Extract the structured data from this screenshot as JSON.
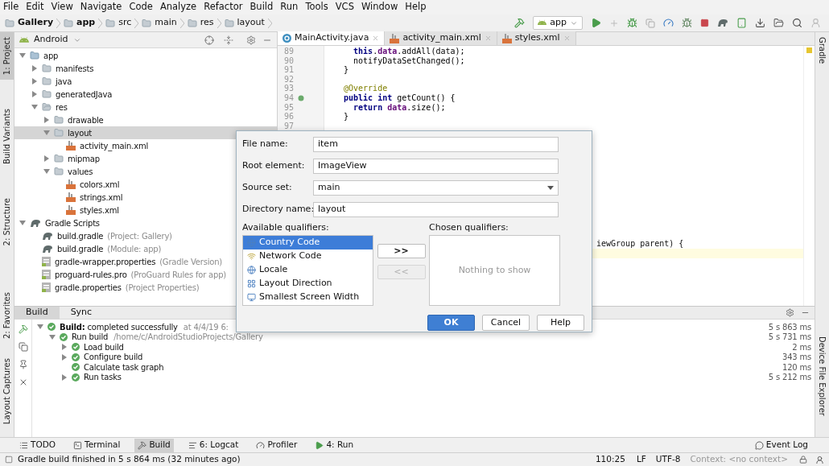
{
  "menu_bar": [
    "File",
    "Edit",
    "View",
    "Navigate",
    "Code",
    "Analyze",
    "Refactor",
    "Build",
    "Run",
    "Tools",
    "VCS",
    "Window",
    "Help"
  ],
  "breadcrumb": [
    "Gallery",
    "app",
    "src",
    "main",
    "res",
    "layout"
  ],
  "run_config": "app",
  "left_stripe_top": [
    {
      "label": "1: Project",
      "selected": true
    },
    {
      "label": "Build Variants",
      "selected": false
    },
    {
      "label": "2: Structure",
      "selected": false
    }
  ],
  "left_stripe_bottom": [
    {
      "label": "2: Favorites",
      "selected": false
    },
    {
      "label": "Layout Captures",
      "selected": false
    }
  ],
  "right_stripe_top": [
    {
      "label": "Gradle"
    }
  ],
  "right_stripe_bottom": [
    {
      "label": "Device File Explorer"
    }
  ],
  "project_panel": {
    "view": "Android",
    "tree": [
      {
        "label": "app",
        "kind": "module",
        "expanded": true,
        "selected": false,
        "children": [
          {
            "label": "manifests",
            "kind": "folder",
            "expanded": false,
            "selected": false
          },
          {
            "label": "java",
            "kind": "folder",
            "expanded": false,
            "selected": false
          },
          {
            "label": "generatedJava",
            "kind": "folder",
            "expanded": false,
            "selected": false
          },
          {
            "label": "res",
            "kind": "resfolder",
            "expanded": true,
            "selected": false,
            "children": [
              {
                "label": "drawable",
                "kind": "folder",
                "expanded": false,
                "selected": false
              },
              {
                "label": "layout",
                "kind": "folder",
                "expanded": true,
                "selected": true,
                "children": [
                  {
                    "label": "activity_main.xml",
                    "kind": "xml",
                    "selected": false
                  }
                ]
              },
              {
                "label": "mipmap",
                "kind": "folder",
                "expanded": false,
                "selected": false
              },
              {
                "label": "values",
                "kind": "folder",
                "expanded": true,
                "selected": false,
                "children": [
                  {
                    "label": "colors.xml",
                    "kind": "xml",
                    "selected": false
                  },
                  {
                    "label": "strings.xml",
                    "kind": "xml",
                    "selected": false
                  },
                  {
                    "label": "styles.xml",
                    "kind": "xml",
                    "selected": false
                  }
                ]
              }
            ]
          }
        ]
      },
      {
        "label": "Gradle Scripts",
        "kind": "gradle",
        "expanded": true,
        "selected": false,
        "children": [
          {
            "label": "build.gradle",
            "secondary": "(Project: Gallery)",
            "kind": "gradle",
            "selected": false
          },
          {
            "label": "build.gradle",
            "secondary": "(Module: app)",
            "kind": "gradle",
            "selected": false
          },
          {
            "label": "gradle-wrapper.properties",
            "secondary": "(Gradle Version)",
            "kind": "props",
            "selected": false
          },
          {
            "label": "proguard-rules.pro",
            "secondary": "(ProGuard Rules for app)",
            "kind": "props",
            "selected": false
          },
          {
            "label": "gradle.properties",
            "secondary": "(Project Properties)",
            "kind": "props",
            "selected": false
          }
        ]
      }
    ]
  },
  "editor": {
    "tabs": [
      {
        "label": "MainActivity.java",
        "kind": "java",
        "selected": true
      },
      {
        "label": "activity_main.xml",
        "kind": "xml",
        "selected": false
      },
      {
        "label": "styles.xml",
        "kind": "xml",
        "selected": false
      }
    ],
    "lines": [
      {
        "number": "89",
        "kind": "plain",
        "segments": [
          {
            "text": "  this",
            "kind": "keyword"
          },
          {
            "text": ".",
            "kind": "plain"
          },
          {
            "text": "data",
            "kind": "field"
          },
          {
            "text": ".addAll(data);",
            "kind": "plain"
          }
        ]
      },
      {
        "number": "90",
        "kind": "plain",
        "segments": [
          {
            "text": "  notifyDataSetChanged();",
            "kind": "plain"
          }
        ]
      },
      {
        "number": "91",
        "kind": "plain",
        "segments": [
          {
            "text": "}",
            "kind": "plain"
          }
        ]
      },
      {
        "number": "92",
        "kind": "plain"
      },
      {
        "number": "93",
        "kind": "plain",
        "segments": [
          {
            "text": "@Override",
            "kind": "annotation"
          }
        ]
      },
      {
        "number": "94",
        "kind": "override",
        "segments": [
          {
            "text": "public int",
            "kind": "keyword"
          },
          {
            "text": " getCount() {",
            "kind": "plain"
          }
        ]
      },
      {
        "number": "95",
        "kind": "plain",
        "segments": [
          {
            "text": "  return",
            "kind": "keyword"
          },
          {
            "text": " data",
            "kind": "field"
          },
          {
            "text": ".size();",
            "kind": "plain"
          }
        ]
      },
      {
        "number": "96",
        "kind": "plain",
        "segments": [
          {
            "text": "}",
            "kind": "plain"
          }
        ]
      },
      {
        "number": "97",
        "kind": "plain"
      }
    ],
    "partial_line": "iewGroup parent) {"
  },
  "dialog": {
    "fields": [
      {
        "label": "File name:",
        "value": "item",
        "kind": "text"
      },
      {
        "label": "Root element:",
        "value": "ImageView",
        "kind": "text"
      },
      {
        "label": "Source set:",
        "value": "main",
        "kind": "dropdown"
      },
      {
        "label": "Directory name:",
        "value": "layout",
        "kind": "text"
      }
    ],
    "available_label": "Available qualifiers:",
    "available": [
      {
        "label": "Country Code",
        "selected": true
      },
      {
        "label": "Network Code",
        "selected": false
      },
      {
        "label": "Locale",
        "selected": false
      },
      {
        "label": "Layout Direction",
        "selected": false
      },
      {
        "label": "Smallest Screen Width",
        "selected": false
      }
    ],
    "add_button": {
      "label": ">>",
      "disabled": false
    },
    "remove_button": {
      "label": "<<",
      "disabled": true
    },
    "chosen_label": "Chosen qualifiers:",
    "chosen_empty": "Nothing to show",
    "buttons": [
      {
        "label": "OK",
        "default": true
      },
      {
        "label": "Cancel",
        "default": false
      },
      {
        "label": "Help",
        "default": false
      }
    ]
  },
  "build_panel": {
    "tabs": [
      {
        "label": "Build",
        "selected": true
      },
      {
        "label": "Sync",
        "selected": false
      }
    ],
    "tree": [
      {
        "label": "**Build:** completed successfully",
        "detail": "at 4/4/19 6:",
        "time": "5 s 863 ms",
        "expanded": true,
        "children": [
          {
            "label": "Run build",
            "detail": "/home/c/AndroidStudioProjects/Gallery",
            "time": "5 s 731 ms",
            "expanded": true,
            "children": [
              {
                "label": "Load build",
                "time": "2 ms",
                "expanded": false
              },
              {
                "label": "Configure build",
                "time": "343 ms",
                "expanded": false
              },
              {
                "label": "Calculate task graph",
                "time": "120 ms"
              },
              {
                "label": "Run tasks",
                "time": "5 s 212 ms",
                "expanded": false
              }
            ]
          }
        ]
      }
    ]
  },
  "tool_windows": [
    {
      "label": "TODO",
      "kind": "todo",
      "selected": false
    },
    {
      "label": "Terminal",
      "kind": "terminal",
      "selected": false
    },
    {
      "label": "Build",
      "kind": "build",
      "selected": true
    },
    {
      "label": "6: Logcat",
      "kind": "logcat",
      "selected": false
    },
    {
      "label": "Profiler",
      "kind": "profiler",
      "selected": false
    },
    {
      "label": "4: Run",
      "kind": "run",
      "selected": false
    }
  ],
  "event_log": "Event Log",
  "status_bar": {
    "message": "Gradle build finished in 5 s 864 ms (32 minutes ago)",
    "position": "110:25",
    "line_separator": "LF",
    "encoding": "UTF-8",
    "context": "Context: <no context>"
  }
}
